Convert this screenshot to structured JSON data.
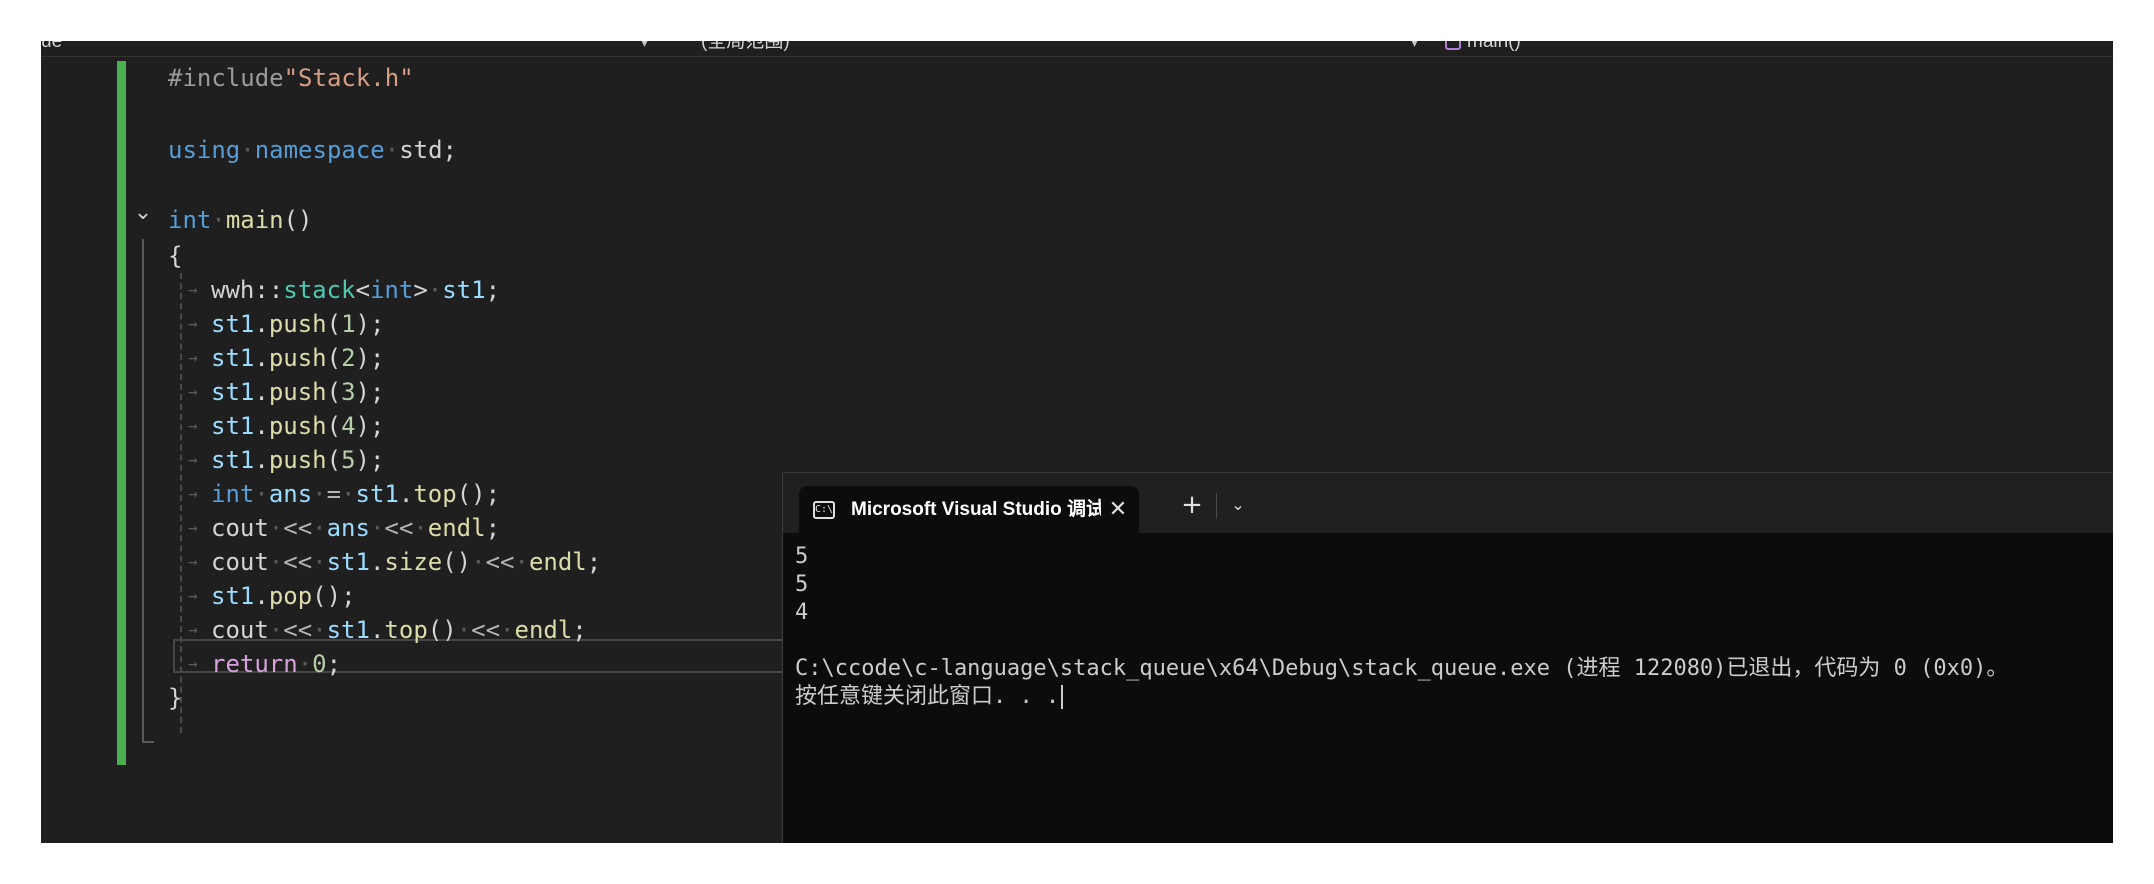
{
  "navbar": {
    "project_scope": "ue",
    "global_scope": "(全局范围)",
    "function_scope": "main()"
  },
  "code": {
    "lines": [
      [
        {
          "t": "#include",
          "c": "pp"
        },
        {
          "t": "\"Stack.h\"",
          "c": "str"
        }
      ],
      [],
      [
        {
          "t": "using",
          "c": "kw"
        },
        {
          "t": "·",
          "c": "ws"
        },
        {
          "t": "namespace",
          "c": "kw"
        },
        {
          "t": "·",
          "c": "ws"
        },
        {
          "t": "std;"
        }
      ],
      [],
      [
        {
          "t": "int",
          "c": "kw"
        },
        {
          "t": "·",
          "c": "ws"
        },
        {
          "t": "main",
          "c": "fn"
        },
        {
          "t": "()"
        }
      ],
      [
        {
          "t": "{"
        }
      ],
      [
        {
          "t": "wwh::"
        },
        {
          "t": "stack",
          "c": "type"
        },
        {
          "t": "<"
        },
        {
          "t": "int",
          "c": "kw"
        },
        {
          "t": ">"
        },
        {
          "t": "·",
          "c": "ws"
        },
        {
          "t": "st1",
          "c": "var"
        },
        {
          "t": ";"
        }
      ],
      [
        {
          "t": "st1",
          "c": "var"
        },
        {
          "t": "."
        },
        {
          "t": "push",
          "c": "fn"
        },
        {
          "t": "("
        },
        {
          "t": "1",
          "c": "num"
        },
        {
          "t": ");"
        }
      ],
      [
        {
          "t": "st1",
          "c": "var"
        },
        {
          "t": "."
        },
        {
          "t": "push",
          "c": "fn"
        },
        {
          "t": "("
        },
        {
          "t": "2",
          "c": "num"
        },
        {
          "t": ");"
        }
      ],
      [
        {
          "t": "st1",
          "c": "var"
        },
        {
          "t": "."
        },
        {
          "t": "push",
          "c": "fn"
        },
        {
          "t": "("
        },
        {
          "t": "3",
          "c": "num"
        },
        {
          "t": ");"
        }
      ],
      [
        {
          "t": "st1",
          "c": "var"
        },
        {
          "t": "."
        },
        {
          "t": "push",
          "c": "fn"
        },
        {
          "t": "("
        },
        {
          "t": "4",
          "c": "num"
        },
        {
          "t": ");"
        }
      ],
      [
        {
          "t": "st1",
          "c": "var"
        },
        {
          "t": "."
        },
        {
          "t": "push",
          "c": "fn"
        },
        {
          "t": "("
        },
        {
          "t": "5",
          "c": "num"
        },
        {
          "t": ");"
        }
      ],
      [
        {
          "t": "int",
          "c": "kw"
        },
        {
          "t": "·",
          "c": "ws"
        },
        {
          "t": "ans",
          "c": "var"
        },
        {
          "t": "·",
          "c": "ws"
        },
        {
          "t": "=",
          "c": "op"
        },
        {
          "t": "·",
          "c": "ws"
        },
        {
          "t": "st1",
          "c": "var"
        },
        {
          "t": "."
        },
        {
          "t": "top",
          "c": "fn"
        },
        {
          "t": "();"
        }
      ],
      [
        {
          "t": "cout"
        },
        {
          "t": "·",
          "c": "ws"
        },
        {
          "t": "<<",
          "c": "op"
        },
        {
          "t": "·",
          "c": "ws"
        },
        {
          "t": "ans",
          "c": "var"
        },
        {
          "t": "·",
          "c": "ws"
        },
        {
          "t": "<<",
          "c": "op"
        },
        {
          "t": "·",
          "c": "ws"
        },
        {
          "t": "endl",
          "c": "fn"
        },
        {
          "t": ";"
        }
      ],
      [
        {
          "t": "cout"
        },
        {
          "t": "·",
          "c": "ws"
        },
        {
          "t": "<<",
          "c": "op"
        },
        {
          "t": "·",
          "c": "ws"
        },
        {
          "t": "st1",
          "c": "var"
        },
        {
          "t": "."
        },
        {
          "t": "size",
          "c": "fn"
        },
        {
          "t": "()"
        },
        {
          "t": "·",
          "c": "ws"
        },
        {
          "t": "<<",
          "c": "op"
        },
        {
          "t": "·",
          "c": "ws"
        },
        {
          "t": "endl",
          "c": "fn"
        },
        {
          "t": ";"
        }
      ],
      [
        {
          "t": "st1",
          "c": "var"
        },
        {
          "t": "."
        },
        {
          "t": "pop",
          "c": "fn"
        },
        {
          "t": "();"
        }
      ],
      [
        {
          "t": "cout"
        },
        {
          "t": "·",
          "c": "ws"
        },
        {
          "t": "<<",
          "c": "op"
        },
        {
          "t": "·",
          "c": "ws"
        },
        {
          "t": "st1",
          "c": "var"
        },
        {
          "t": "."
        },
        {
          "t": "top",
          "c": "fn"
        },
        {
          "t": "()"
        },
        {
          "t": "·",
          "c": "ws"
        },
        {
          "t": "<<",
          "c": "op"
        },
        {
          "t": "·",
          "c": "ws"
        },
        {
          "t": "endl",
          "c": "fn"
        },
        {
          "t": ";"
        }
      ],
      [
        {
          "t": "return",
          "c": "ctl"
        },
        {
          "t": "·",
          "c": "ws"
        },
        {
          "t": "0",
          "c": "num"
        },
        {
          "t": ";"
        }
      ],
      [
        {
          "t": "}"
        }
      ]
    ]
  },
  "console": {
    "tab_title": "Microsoft Visual Studio 调试控制台",
    "tab_icon": "terminal-icon",
    "close_glyph": "✕",
    "new_tab_glyph": "+",
    "dropdown_glyph": "⌄",
    "output_lines": [
      "5",
      "5",
      "4",
      "",
      "C:\\ccode\\c-language\\stack_queue\\x64\\Debug\\stack_queue.exe (进程 122080)已退出，代码为 0 (0x0)。",
      "按任意键关闭此窗口. . ."
    ]
  },
  "colors": {
    "editor_bg": "#1f1f1f",
    "keyword": "#569cd6",
    "function": "#dcdcaa",
    "type": "#4ec9b0",
    "string": "#d69d85",
    "variable": "#9cdcfe",
    "number": "#b5cea8",
    "control": "#d8a0df",
    "change_bar": "#4caf50",
    "console_bg": "#0c0c0c"
  }
}
